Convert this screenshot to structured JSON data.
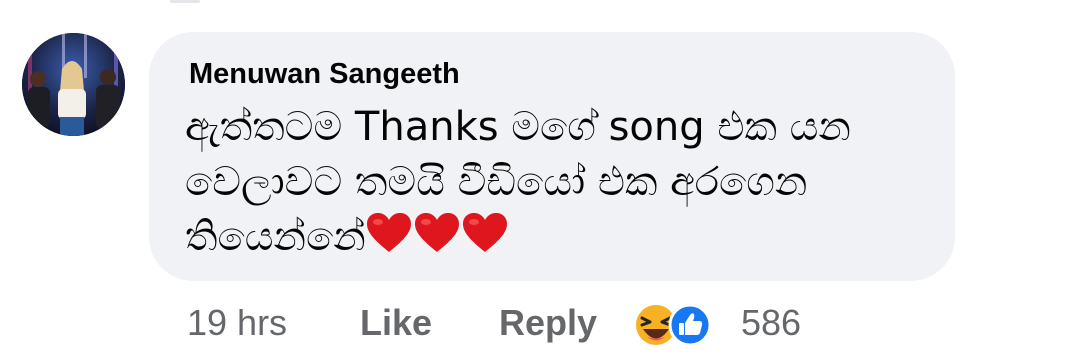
{
  "comment": {
    "author": "Menuwan Sangeeth",
    "text_lines": [
      "ඇත්තටම Thanks මගේ song එක යන",
      "වෙලාවට තමයි වීඩියෝ එක අරගෙන",
      "තියෙන්නේ"
    ],
    "trailing_emoji": [
      "heart-icon",
      "heart-icon",
      "heart-icon"
    ]
  },
  "actions": {
    "time": "19 hrs",
    "like_label": "Like",
    "reply_label": "Reply",
    "reaction_icons": [
      "haha-icon",
      "like-icon"
    ],
    "reaction_count": "586"
  },
  "colors": {
    "bubble": "#f0f2f5",
    "name_text": "#050505",
    "meta_text": "#65676b",
    "like_blue": "#1877f2",
    "haha_yellow": "#f7b125",
    "heart_red": "#e0161f"
  }
}
